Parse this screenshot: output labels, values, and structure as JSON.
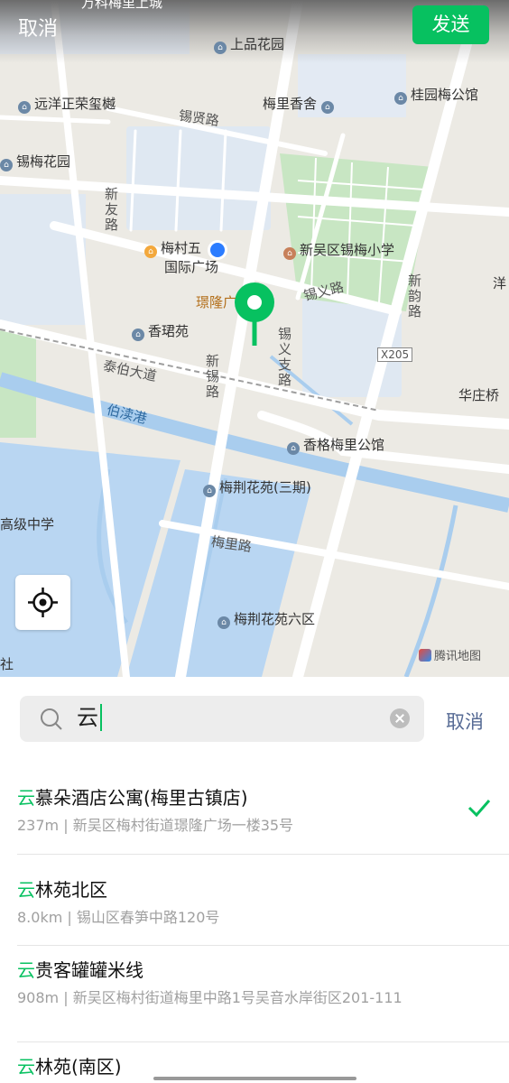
{
  "header": {
    "cancel_label": "取消",
    "send_label": "发送"
  },
  "map": {
    "pois": [
      {
        "label": "上品花园"
      },
      {
        "label": "远洋正荣玺樾"
      },
      {
        "label": "梅里香舍"
      },
      {
        "label": "桂园梅公馆"
      },
      {
        "label": "锡梅花园"
      },
      {
        "label": "梅村五"
      },
      {
        "label": "国际广场"
      },
      {
        "label": "新吴区锡梅小学"
      },
      {
        "label": "璟隆广"
      },
      {
        "label": "香珺苑"
      },
      {
        "label": "香格梅里公馆"
      },
      {
        "label": "梅荆花苑(三期)"
      },
      {
        "label": "梅荆花苑六区"
      },
      {
        "label": "华庄桥"
      },
      {
        "label": "高级中学"
      },
      {
        "label": "洋"
      }
    ],
    "roads": [
      {
        "label": "锡贤路"
      },
      {
        "label": "新友路"
      },
      {
        "label": "锡义路"
      },
      {
        "label": "新韵路"
      },
      {
        "label": "锡义支路"
      },
      {
        "label": "新锡路"
      },
      {
        "label": "泰伯大道"
      },
      {
        "label": "梅里路"
      },
      {
        "label": "X205"
      }
    ],
    "river_label": "伯渎港",
    "attribution": "腾讯地图",
    "top_partial_label": "万科梅里上城",
    "left_partial_label": "社"
  },
  "search": {
    "query": "云",
    "cancel_label": "取消"
  },
  "results": [
    {
      "highlight": "云",
      "rest": "慕朵酒店公寓(梅里古镇店)",
      "address": "237m | 新吴区梅村街道璟隆广场一楼35号",
      "selected": true
    },
    {
      "highlight": "云",
      "rest": "林苑北区",
      "address": "8.0km | 锡山区春笋中路120号",
      "selected": false
    },
    {
      "highlight": "云",
      "rest": "贵客罐罐米线",
      "address": "908m | 新吴区梅村街道梅里中路1号吴音水岸街区201-111",
      "selected": false
    },
    {
      "highlight": "云",
      "rest": "林苑(南区)",
      "address": "",
      "selected": false
    }
  ],
  "colors": {
    "accent": "#07c160",
    "link": "#576b95",
    "water": "#b9d6f2",
    "green": "#c8e6c3"
  }
}
